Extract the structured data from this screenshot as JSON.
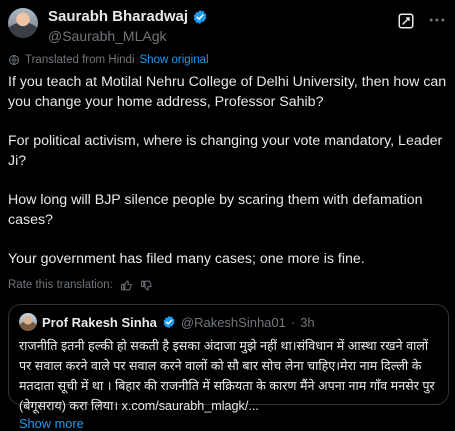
{
  "author": {
    "display_name": "Saurabh Bharadwaj",
    "handle": "@Saurabh_MLAgk"
  },
  "translation": {
    "note": "Translated from Hindi",
    "show_original": "Show original",
    "rate": "Rate this translation:"
  },
  "tweet": {
    "paragraphs": [
      "If you teach at Motilal Nehru College of Delhi University, then how can you change your home address, Professor Sahib?",
      "For political activism, where is changing your vote mandatory, Leader Ji?",
      "How long will BJP silence people by scaring them with defamation cases?",
      "Your government has filed many cases; one more is fine."
    ]
  },
  "quote": {
    "display_name": "Prof Rakesh Sinha",
    "handle": "@RakeshSinha01",
    "separator": "·",
    "time": "3h",
    "text": "राजनीति इतनी हल्की हो सकती है इसका अंदाजा मुझे नहीं था।संविधान में आस्था रखने वालों पर सवाल करने वाले पर सवाल करने वालों को सौ बार सोच लेना चाहिए।मेरा नाम दिल्ली के मतदाता सूची में था । बिहार की राजनीति में सक्रियता के कारण मैंने अपना नाम गाँव मनसेर पुर (बेगूसराय) करा लिया। x.com/saurabh_mlagk/...",
    "show_more": "Show more"
  },
  "icons": {
    "verified": "verified-badge-icon",
    "grok": "grok-icon",
    "more": "more-options-icon",
    "globe": "globe-icon",
    "thumbs_up": "thumbs-up-icon",
    "thumbs_down": "thumbs-down-icon"
  },
  "colors": {
    "background": "#000000",
    "text": "#e7e9ea",
    "muted": "#71767b",
    "accent": "#1d9bf0",
    "border": "#2f3336"
  }
}
